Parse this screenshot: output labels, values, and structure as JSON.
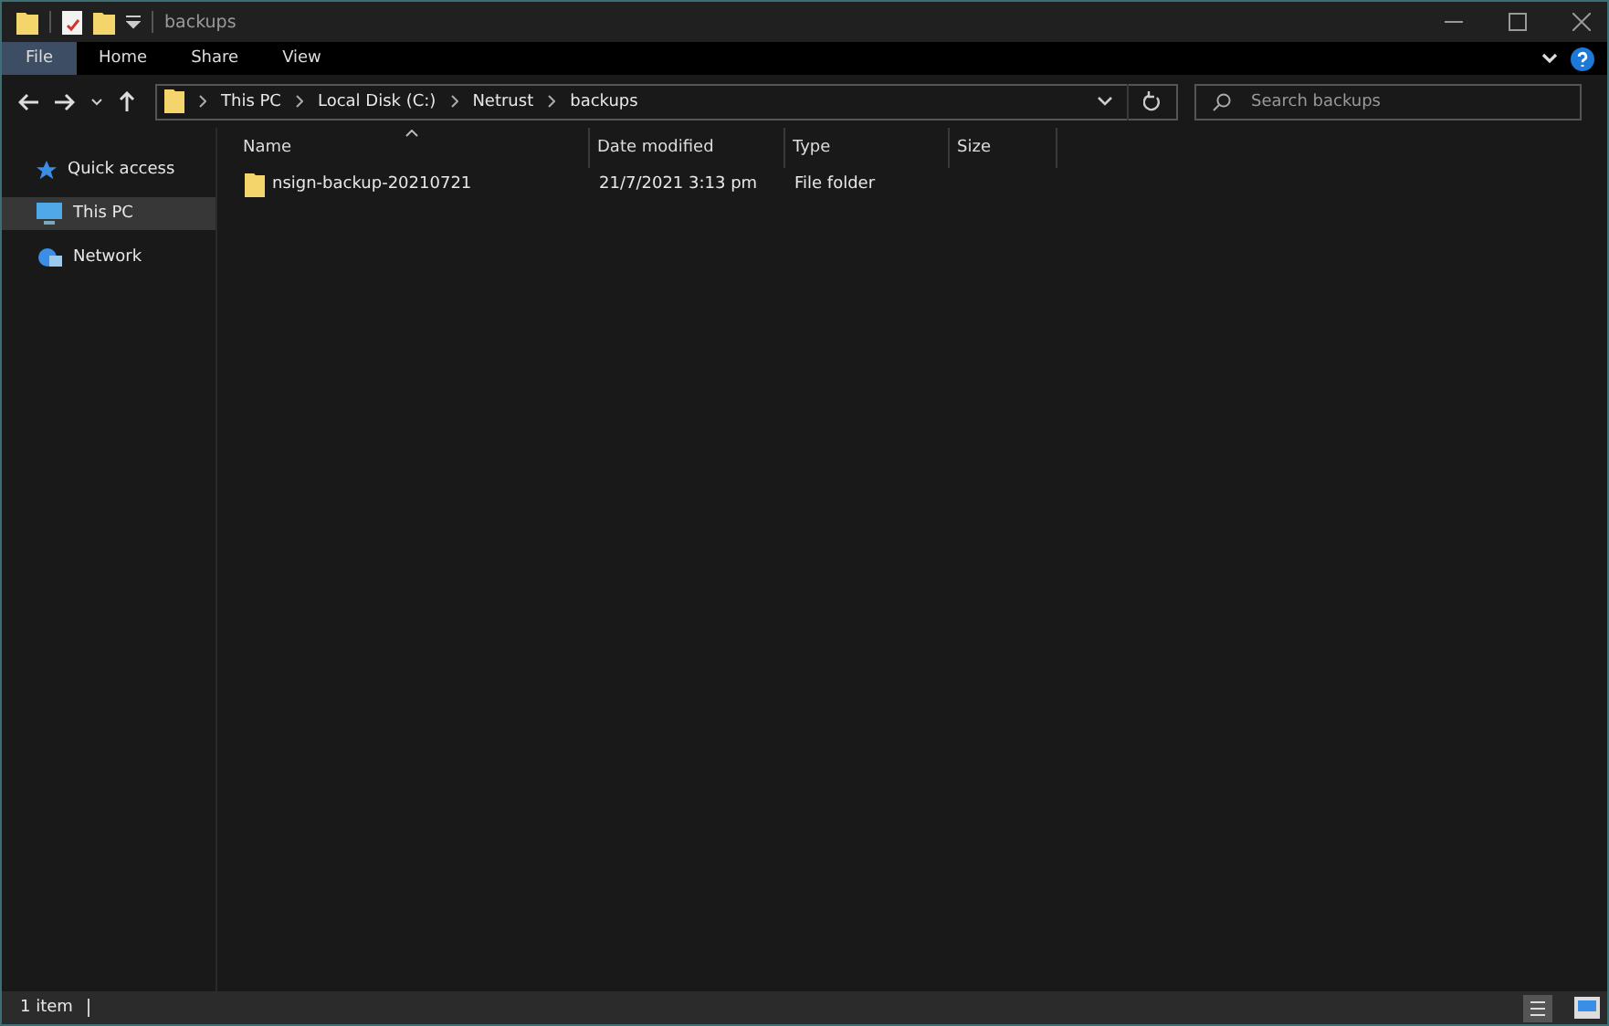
{
  "window": {
    "title": "backups"
  },
  "ribbon": {
    "tabs": [
      {
        "label": "File",
        "selected": true
      },
      {
        "label": "Home",
        "selected": false
      },
      {
        "label": "Share",
        "selected": false
      },
      {
        "label": "View",
        "selected": false
      }
    ]
  },
  "address_bar": {
    "crumbs": [
      "This PC",
      "Local Disk (C:)",
      "Netrust",
      "backups"
    ]
  },
  "search": {
    "placeholder": "Search backups"
  },
  "sidebar": {
    "items": [
      {
        "label": "Quick access",
        "kind": "star",
        "selected": false
      },
      {
        "label": "This PC",
        "kind": "pc",
        "selected": true
      },
      {
        "label": "Network",
        "kind": "network",
        "selected": false
      }
    ]
  },
  "table": {
    "columns": [
      "Name",
      "Date modified",
      "Type",
      "Size"
    ],
    "rows": [
      {
        "name": "nsign-backup-20210721",
        "date_modified": "21/7/2021 3:13 pm",
        "type": "File folder"
      }
    ]
  },
  "status_bar": {
    "count": "1 item"
  }
}
